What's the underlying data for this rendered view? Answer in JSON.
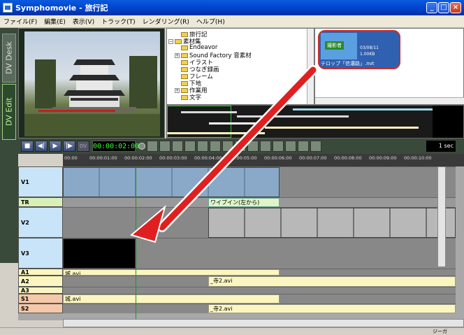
{
  "window": {
    "title": "Symphomovie - 旅行記"
  },
  "menu": [
    "ファイル(F)",
    "編集(E)",
    "表示(V)",
    "トラック(T)",
    "レンダリング(R)",
    "ヘルプ(H)"
  ],
  "sidetabs": {
    "dv_desk": "DV Desk",
    "dv_edit": "DV Edit"
  },
  "tree": {
    "items": [
      {
        "label": "旅行記",
        "level": 2,
        "expander": ""
      },
      {
        "label": "素材集",
        "level": 0,
        "expander": "−"
      },
      {
        "label": "Endeavor",
        "level": 1,
        "expander": ""
      },
      {
        "label": "Sound Factory 音素材",
        "level": 1,
        "expander": "+"
      },
      {
        "label": "イラスト",
        "level": 1,
        "expander": ""
      },
      {
        "label": "つなぎ録画",
        "level": 1,
        "expander": ""
      },
      {
        "label": "フレーム",
        "level": 1,
        "expander": ""
      },
      {
        "label": "下地",
        "level": 1,
        "expander": ""
      },
      {
        "label": "作業用",
        "level": 1,
        "expander": "+"
      },
      {
        "label": "文字",
        "level": 1,
        "expander": ""
      }
    ]
  },
  "library": {
    "thumb_badge": "撮影者",
    "thumb_date": "03/08/11",
    "thumb_size": "1.00KB",
    "thumb_name": "テロップ「信濃路」.nvt"
  },
  "controls": {
    "timecode": "00:00:02:00",
    "dv_label": "DV",
    "scale": "1 sec"
  },
  "ruler": [
    "00:00",
    "00:00:01:00",
    "00:00:02:00",
    "00:00:03:00",
    "00:00:04:00",
    "00:00:05:00",
    "00:00:06:00",
    "00:00:07:00",
    "00:00:08:00",
    "00:00:09:00",
    "00:00:10:00"
  ],
  "tracks": {
    "v1": "V1",
    "tr": "TR",
    "v2": "V2",
    "v3": "V3",
    "a1": "A1",
    "a2": "A2",
    "a3": "A3",
    "s1": "S1",
    "s2": "S2"
  },
  "clips": {
    "transition": "ワイプイン(左から)",
    "a1": "城.avi",
    "a2": "_寺2.avi",
    "s1": "城.avi",
    "s2": "_寺2.avi"
  },
  "status": {
    "text": "ジーガ"
  },
  "colors": {
    "highlight_arrow": "#e02020",
    "video_track": "#c8e4f8",
    "audio_track": "#fbf6c0",
    "sound_track": "#f4c8a8"
  }
}
